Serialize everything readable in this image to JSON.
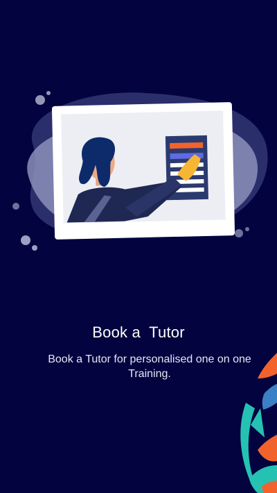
{
  "onboarding": {
    "title": "Book a  Tutor",
    "subtitle": "Book a Tutor for personalised one on one Training."
  },
  "illustration": {
    "icon": "tutor-presentation-illustration"
  },
  "decoration": {
    "icon": "pattern-corner-decoration"
  },
  "colors": {
    "background": "#03033f",
    "blob": "#8b8fb8",
    "accent_orange": "#f2632b",
    "accent_teal": "#25c2b4",
    "accent_blue": "#3b7fc4",
    "hair": "#0d2a6b",
    "hand": "#f6b634"
  }
}
